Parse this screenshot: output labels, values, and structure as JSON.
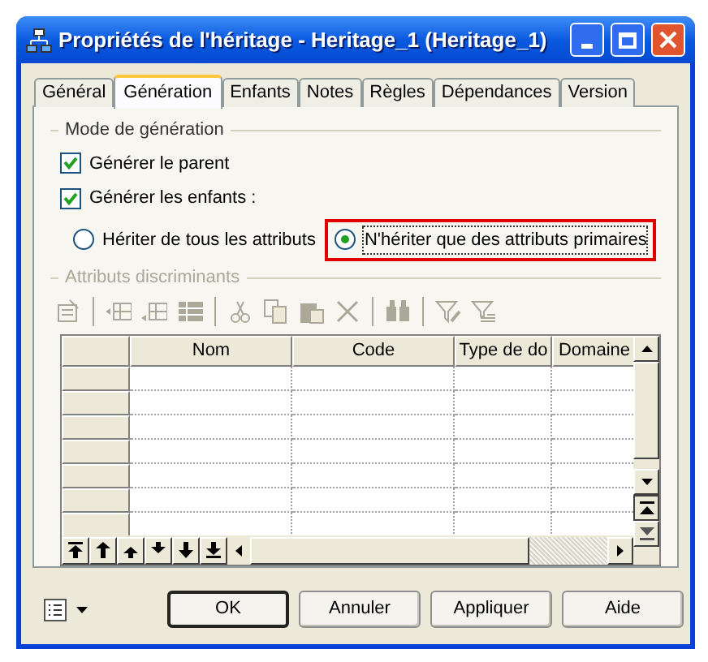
{
  "window": {
    "title": "Propriétés de l'héritage - Heritage_1 (Heritage_1)"
  },
  "tabs": [
    {
      "label": "Général",
      "selected": false
    },
    {
      "label": "Génération",
      "selected": true
    },
    {
      "label": "Enfants",
      "selected": false
    },
    {
      "label": "Notes",
      "selected": false
    },
    {
      "label": "Règles",
      "selected": false
    },
    {
      "label": "Dépendances",
      "selected": false
    },
    {
      "label": "Version",
      "selected": false
    }
  ],
  "generation_mode": {
    "title": "Mode de génération",
    "checkboxes": [
      {
        "label": "Générer le parent",
        "checked": true
      },
      {
        "label": "Générer les enfants :",
        "checked": true
      }
    ],
    "radios": [
      {
        "label": "Hériter de tous les attributs",
        "selected": false,
        "highlighted": false
      },
      {
        "label": "N'hériter que des attributs primaires",
        "selected": true,
        "highlighted": true
      }
    ]
  },
  "discriminant_attributes": {
    "title": "Attributs discriminants",
    "disabled": true,
    "columns": [
      "Nom",
      "Code",
      "Type de do",
      "Domaine"
    ]
  },
  "buttons": [
    {
      "label": "OK",
      "default": true
    },
    {
      "label": "Annuler",
      "default": false
    },
    {
      "label": "Appliquer",
      "default": false
    },
    {
      "label": "Aide",
      "default": false
    }
  ]
}
